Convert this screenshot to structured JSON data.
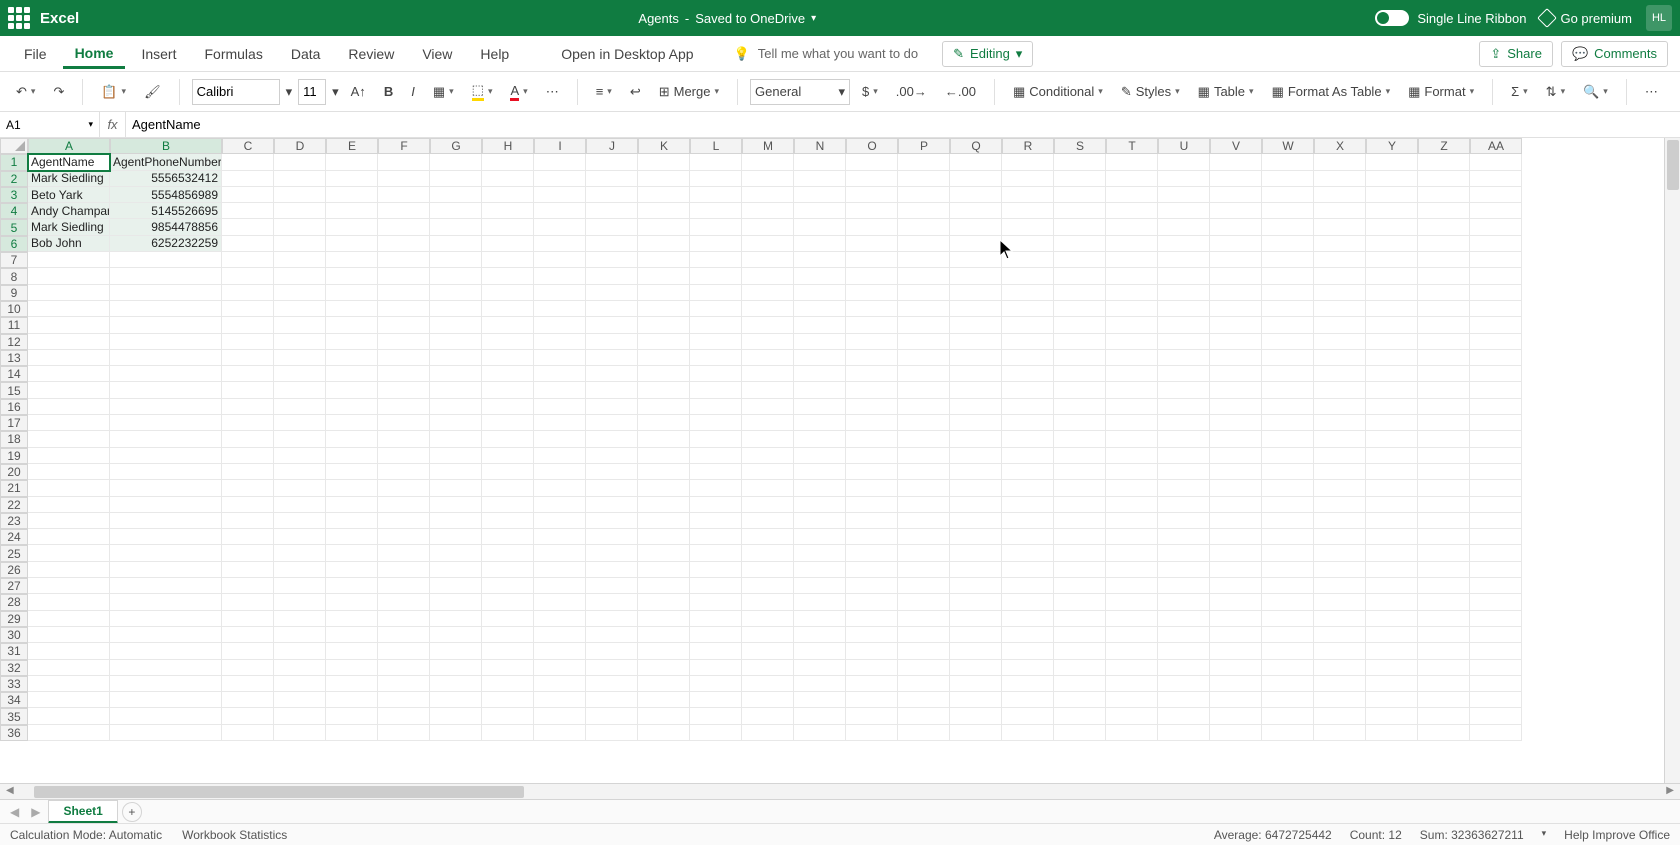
{
  "app": {
    "name": "Excel",
    "docTitle": "Agents",
    "saveStatus": "Saved to OneDrive"
  },
  "titlebar": {
    "singleLineRibbon": "Single Line Ribbon",
    "goPremium": "Go premium",
    "userInitials": "HL"
  },
  "menu": {
    "tabs": [
      "File",
      "Home",
      "Insert",
      "Formulas",
      "Data",
      "Review",
      "View",
      "Help"
    ],
    "activeTab": "Home",
    "openDesktop": "Open in Desktop App",
    "tellMe": "Tell me what you want to do",
    "editing": "Editing",
    "share": "Share",
    "comments": "Comments"
  },
  "ribbon": {
    "fontName": "Calibri",
    "fontSize": "11",
    "merge": "Merge",
    "numberFormat": "General",
    "conditional": "Conditional",
    "styles": "Styles",
    "table": "Table",
    "formatAsTable": "Format As Table",
    "format": "Format"
  },
  "nameBox": "A1",
  "formulaBar": "AgentName",
  "sheet": {
    "activeName": "Sheet1"
  },
  "columns": [
    "A",
    "B",
    "C",
    "D",
    "E",
    "F",
    "G",
    "H",
    "I",
    "J",
    "K",
    "L",
    "M",
    "N",
    "O",
    "P",
    "Q",
    "R",
    "S",
    "T",
    "U",
    "V",
    "W",
    "X",
    "Y",
    "Z",
    "AA"
  ],
  "selectedCols": [
    "A",
    "B"
  ],
  "selectedRows": [
    1,
    2,
    3,
    4,
    5,
    6
  ],
  "cells": {
    "A1": "AgentName",
    "B1": "AgentPhoneNumber",
    "A2": "Mark Siedling",
    "B2": "5556532412",
    "A3": "Beto Yark",
    "B3": "5554856989",
    "A4": "Andy Champan",
    "B4": "5145526695",
    "A5": "Mark Siedling",
    "B5": "9854478856",
    "A6": "Bob John",
    "B6": "6252232259"
  },
  "status": {
    "calcMode": "Calculation Mode: Automatic",
    "wbStats": "Workbook Statistics",
    "average": "Average: 6472725442",
    "count": "Count: 12",
    "sum": "Sum: 32363627211",
    "help": "Help Improve Office"
  }
}
